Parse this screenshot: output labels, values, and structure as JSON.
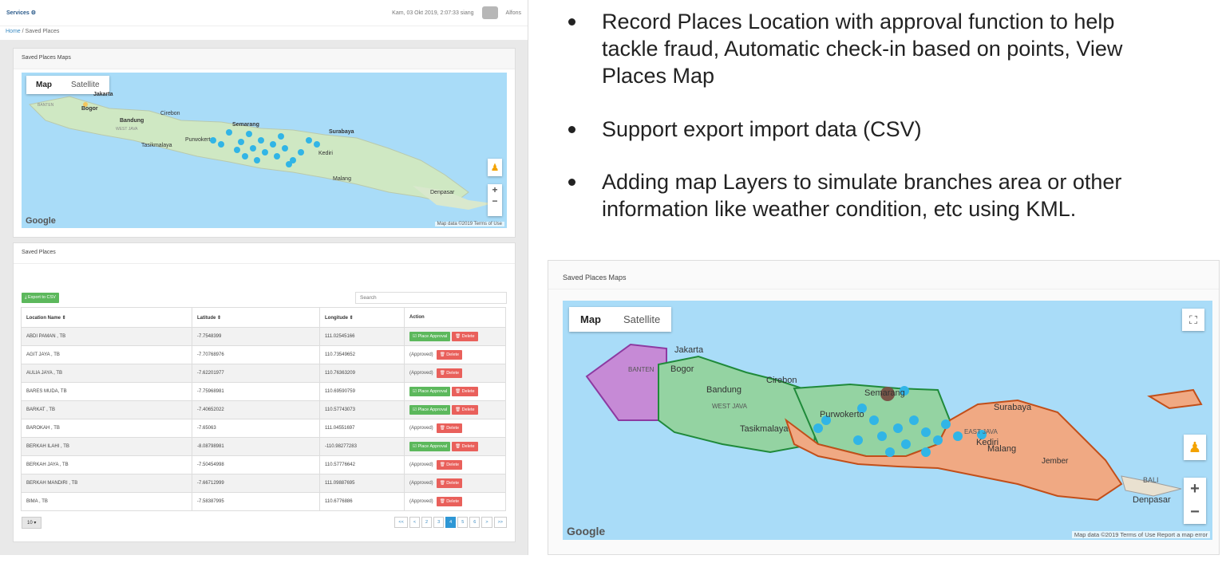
{
  "app": {
    "brand": "Services",
    "datetime": "Kam, 03 Okt 2019, 2:07:33 siang",
    "user": "Alfons"
  },
  "breadcrumb": {
    "home": "Home",
    "separator": "/",
    "current": "Saved Places"
  },
  "maps_panel": {
    "title": "Saved Places Maps",
    "map_tab": "Map",
    "satellite_tab": "Satellite",
    "google": "Google",
    "footer": "Map data ©2019   Terms of Use",
    "zoom_in": "+",
    "zoom_out": "−",
    "cities": [
      "Jakarta",
      "Bogor",
      "Cirebon",
      "Bandung",
      "Semarang",
      "Surabaya",
      "Tasikmalaya",
      "Purwokerto",
      "Kediri",
      "Malang",
      "Denpasar",
      "BANTEN",
      "WEST JAVA"
    ]
  },
  "places_panel": {
    "title": "Saved Places",
    "export_button": "Export to CSV",
    "search_placeholder": "Search",
    "columns": [
      "Location Name",
      "Latitude",
      "Longitude",
      "Action"
    ],
    "approve_label": "Place Approval",
    "delete_label": "Delete",
    "approved_label": "(Approved)",
    "rows": [
      {
        "name": "ABDI PAMAN , TB",
        "lat": "-7.7548399",
        "lng": "111.02545166",
        "approved": false
      },
      {
        "name": "AGIT JAYA , TB",
        "lat": "-7.70768976",
        "lng": "110.73549652",
        "approved": true
      },
      {
        "name": "AULIA JAYA , TB",
        "lat": "-7.62201977",
        "lng": "110.76363209",
        "approved": true
      },
      {
        "name": "BARES MUDA, TB",
        "lat": "-7.75968981",
        "lng": "110.69590759",
        "approved": false
      },
      {
        "name": "BARKAT , TB",
        "lat": "-7.40652022",
        "lng": "110.57743073",
        "approved": false
      },
      {
        "name": "BAROKAH , TB",
        "lat": "-7.65063",
        "lng": "111.04551697",
        "approved": true
      },
      {
        "name": "BERKAH ILAHI , TB",
        "lat": "-8.08798981",
        "lng": "-110.98277283",
        "approved": false
      },
      {
        "name": "BERKAH JAYA , TB",
        "lat": "-7.50454998",
        "lng": "110.57776642",
        "approved": true
      },
      {
        "name": "BERKAH MANDIRI , TB",
        "lat": "-7.66712999",
        "lng": "111.09887695",
        "approved": true
      },
      {
        "name": "BIMA , TB",
        "lat": "-7.58387995",
        "lng": "110.6776886",
        "approved": true
      }
    ],
    "page_size": "10 ▾",
    "pager": [
      "<<",
      "<",
      "2",
      "3",
      "4",
      "5",
      "6",
      ">",
      ">>"
    ],
    "active_page": "4"
  },
  "bullets": [
    "Record Places Location with approval function to help tackle fraud, Automatic check-in based on points, View Places Map",
    "Support export import data (CSV)",
    "Adding map Layers to simulate branches area or other information like weather condition, etc using KML."
  ],
  "kml_panel": {
    "title": "Saved Places Maps",
    "map_tab": "Map",
    "satellite_tab": "Satellite",
    "google": "Google",
    "footer": "Map data ©2019   Terms of Use   Report a map error",
    "cities": [
      "Jakarta",
      "Bogor",
      "Cirebon",
      "Bandung",
      "WEST JAVA",
      "Tasikmalaya",
      "Purwokerto",
      "Semarang",
      "Surabaya",
      "Kediri",
      "Malang",
      "Jember",
      "BALI",
      "Denpasar",
      "BANTEN",
      "EAST JAVA"
    ]
  },
  "colors": {
    "accent": "#2e97d5",
    "green": "#5cb85c",
    "red": "#e9605b",
    "water": "#a9dcf8",
    "pin": "#31b5e6"
  }
}
